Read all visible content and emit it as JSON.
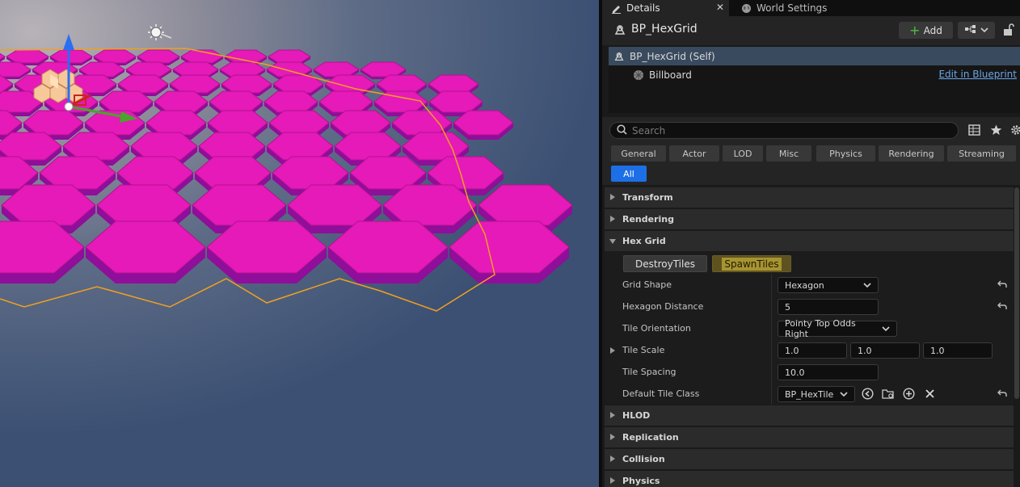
{
  "tabs": [
    {
      "label": "Details",
      "active": true
    },
    {
      "label": "World Settings",
      "active": false
    }
  ],
  "header": {
    "actor_name": "BP_HexGrid",
    "add_label": "Add"
  },
  "components": {
    "self_label": "BP_HexGrid (Self)",
    "child_label": "Billboard",
    "edit_link": "Edit in Blueprint"
  },
  "search": {
    "placeholder": "Search"
  },
  "filters": [
    "General",
    "Actor",
    "LOD",
    "Misc",
    "Physics",
    "Rendering",
    "Streaming",
    "All"
  ],
  "categories": {
    "transform": "Transform",
    "rendering": "Rendering",
    "hex_grid": "Hex Grid",
    "hlod": "HLOD",
    "replication": "Replication",
    "collision": "Collision",
    "physics": "Physics"
  },
  "hex_grid": {
    "destroy_label": "DestroyTiles",
    "spawn_label": "SpawnTiles",
    "grid_shape_label": "Grid Shape",
    "grid_shape_value": "Hexagon",
    "hex_distance_label": "Hexagon Distance",
    "hex_distance_value": "5",
    "tile_orientation_label": "Tile Orientation",
    "tile_orientation_value": "Pointy Top Odds Right",
    "tile_scale_label": "Tile Scale",
    "tile_scale_x": "1.0",
    "tile_scale_y": "1.0",
    "tile_scale_z": "1.0",
    "tile_spacing_label": "Tile Spacing",
    "tile_spacing_value": "10.0",
    "default_tile_class_label": "Default Tile Class",
    "default_tile_class_value": "BP_HexTile"
  },
  "colors": {
    "hex_top": "#e51ab8",
    "hex_side": "#8f0e9a",
    "selection_outline": "#f0a020",
    "accent_blue": "#1d6fe6"
  }
}
